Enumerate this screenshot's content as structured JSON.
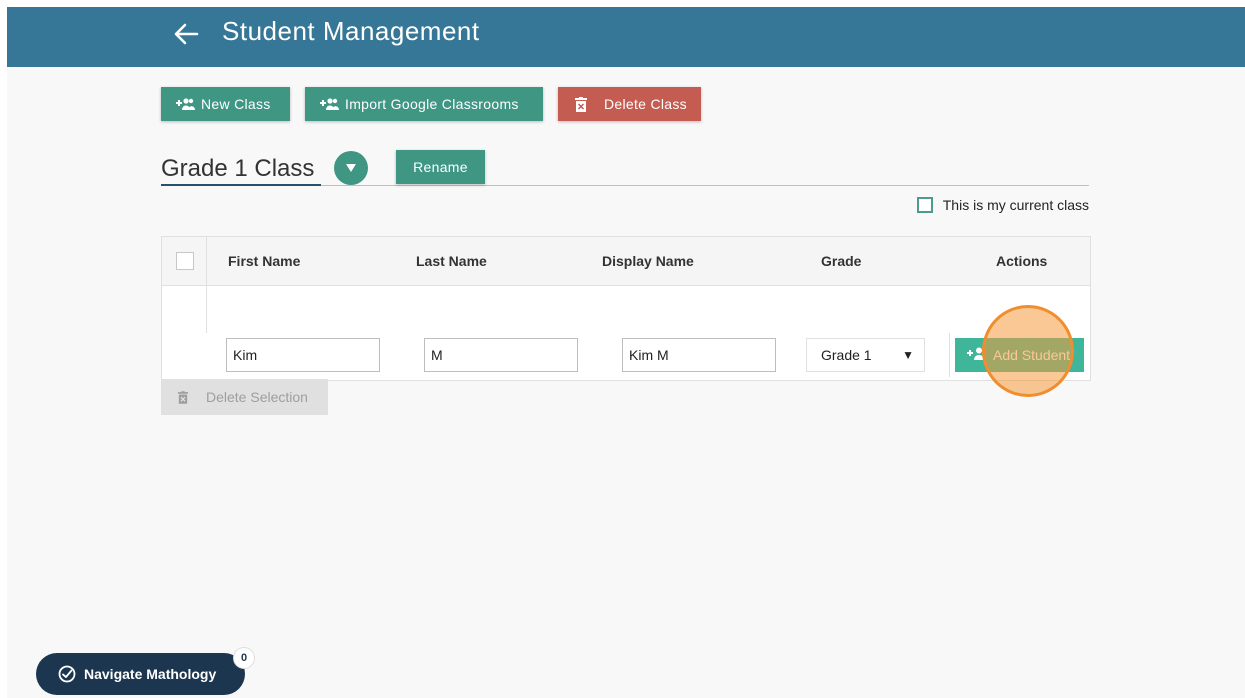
{
  "header": {
    "title": "Student Management"
  },
  "toolbar": {
    "new_class": "New Class",
    "import_google": "Import Google Classrooms",
    "delete_class": "Delete Class"
  },
  "class": {
    "name": "Grade 1 Class",
    "rename": "Rename",
    "current_class_label": "This is my current class"
  },
  "table": {
    "columns": [
      "First Name",
      "Last Name",
      "Display Name",
      "Grade",
      "Actions"
    ],
    "new_row": {
      "first_name": "Kim",
      "last_name": "M",
      "display_name": "Kim M",
      "grade": "Grade 1",
      "add_button": "Add Student"
    }
  },
  "delete_selection": "Delete Selection",
  "navigator": {
    "label": "Navigate Mathology",
    "badge": "0"
  },
  "colors": {
    "header": "#367696",
    "green": "#3e9683",
    "red": "#c45c52",
    "add_student": "#3fb59a",
    "highlight": "#f08d2e",
    "navigator": "#1c3650"
  }
}
